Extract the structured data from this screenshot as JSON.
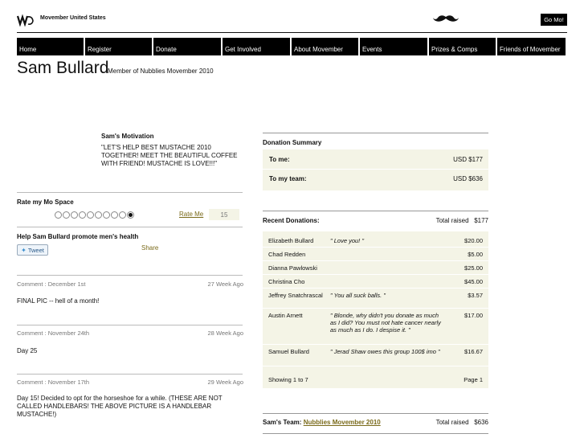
{
  "header": {
    "site_title": "Movember United States",
    "go_button": "Go Mo!",
    "logo_icon": "movember-logo-icon",
    "mustache_icon": "mustache-icon"
  },
  "nav": [
    {
      "label": "Home"
    },
    {
      "label": "Register"
    },
    {
      "label": "Donate"
    },
    {
      "label": "Get Involved"
    },
    {
      "label": "About Movember"
    },
    {
      "label": "Events"
    },
    {
      "label": "Prizes & Comps"
    },
    {
      "label": "Friends of Movember"
    }
  ],
  "profile": {
    "name": "Sam Bullard",
    "member_of": "Member of Nubblies Movember 2010"
  },
  "motivation": {
    "title": "Sam's Motivation",
    "text": "\"LET'S HELP BEST MUSTACHE 2010 TOGETHER! MEET THE BEAUTIFUL COFFEE WITH FRIEND! MUSTACHE IS LOVE!!!\""
  },
  "rating": {
    "title": "Rate my Mo Space",
    "circle_count": 10,
    "selected_index": 9,
    "rate_link": "Rate Me",
    "count": "15"
  },
  "promote": {
    "title": "Help Sam Bullard promote men's health",
    "tweet_label": "Tweet",
    "share_label": "Share"
  },
  "comments": [
    {
      "date": "Comment : December 1st",
      "age": "27 Week Ago",
      "text": "FINAL PIC -- hell of a month!"
    },
    {
      "date": "Comment : November 24th",
      "age": "28 Week Ago",
      "text": "Day 25"
    },
    {
      "date": "Comment : November 17th",
      "age": "29 Week Ago",
      "text": "Day 15! Decided to opt for the horseshoe for a while. (THESE ARE NOT CALLED HANDLEBARS! THE ABOVE PICTURE IS A HANDLEBAR MUSTACHE!)"
    }
  ],
  "summary": {
    "title": "Donation Summary",
    "to_me_label": "To me:",
    "to_me_value": "USD $177",
    "to_team_label": "To my team:",
    "to_team_value": "USD $636"
  },
  "recent": {
    "title": "Recent Donations:",
    "total_label": "Total raised",
    "total_value": "$177",
    "donations": [
      {
        "name": "Elizabeth Bullard",
        "message": "\" Love you! \"",
        "amount": "$20.00"
      },
      {
        "name": "Chad Redden",
        "message": "",
        "amount": "$5.00"
      },
      {
        "name": "Dianna Pawlowski",
        "message": "",
        "amount": "$25.00"
      },
      {
        "name": "Christina Cho",
        "message": "",
        "amount": "$45.00"
      },
      {
        "name": "Jeffrey Snatchrascal",
        "message": "\" You all suck balls. \"",
        "amount": "$3.57"
      },
      {
        "name": "Austin Arnett",
        "message": "\" Blonde, why didn't you donate as much as I did? You must not hate cancer nearly as much as I do. I despise it. \"",
        "amount": "$17.00"
      },
      {
        "name": "Samuel Bullard",
        "message": "\" Jerad Shaw owes this group 100$ imo \"",
        "amount": "$16.67"
      }
    ],
    "showing": "Showing 1 to 7",
    "page": "Page 1"
  },
  "team": {
    "label": "Sam's Team:",
    "link": "Nubblies Movember 2010",
    "total_label": "Total raised",
    "total_value": "$636"
  }
}
